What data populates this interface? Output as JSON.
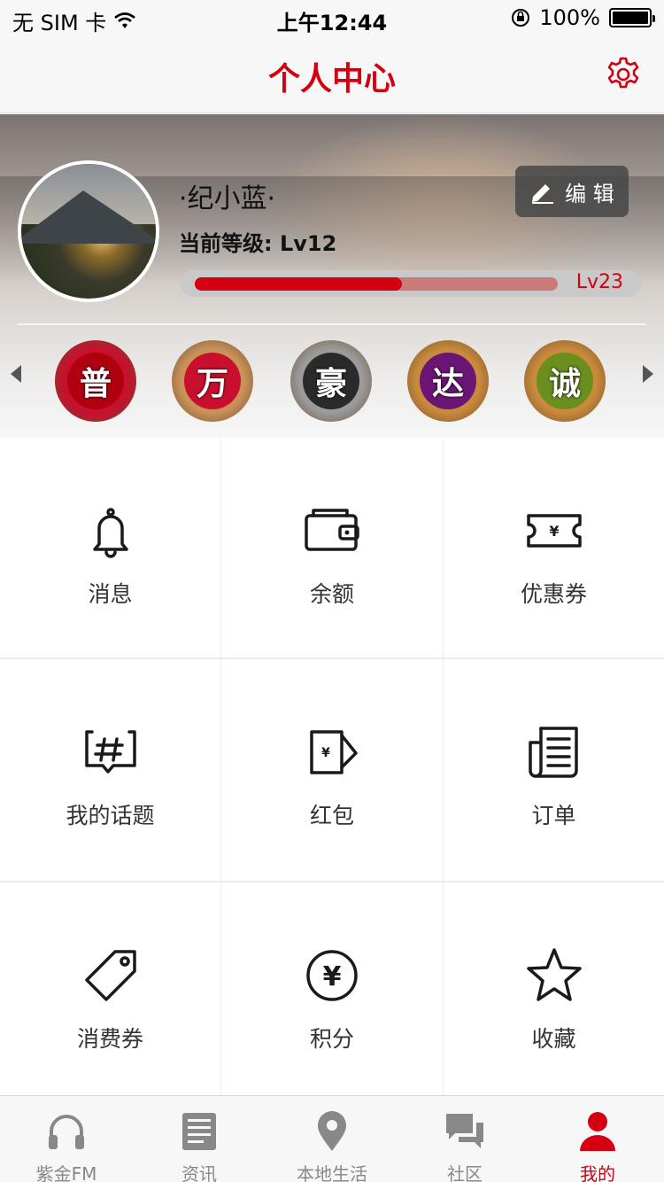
{
  "status_bar": {
    "carrier": "无 SIM 卡",
    "time": "上午12:44",
    "battery": "100%"
  },
  "nav": {
    "title": "个人中心",
    "settings_icon": "gear-icon"
  },
  "profile": {
    "username": "·纪小蓝·",
    "level_label": "当前等级: ",
    "level_value": "Lv12",
    "edit_label": "编 辑",
    "progress_fraction": 0.57,
    "next_level": "Lv23"
  },
  "badges": [
    {
      "char": "普",
      "ring": "#c8102e",
      "inner": "#b0000f"
    },
    {
      "char": "万",
      "ring": "#c9925a",
      "inner": "#c8102e"
    },
    {
      "char": "豪",
      "ring": "#9b9b9b",
      "inner": "#2a2a2a"
    },
    {
      "char": "达",
      "ring": "#c98a3c",
      "inner": "#6b1675"
    },
    {
      "char": "诚",
      "ring": "#c98a3c",
      "inner": "#6a8f1f"
    }
  ],
  "grid": [
    {
      "label": "消息",
      "icon": "bell-icon"
    },
    {
      "label": "余额",
      "icon": "wallet-icon"
    },
    {
      "label": "优惠券",
      "icon": "coupon-icon"
    },
    {
      "label": "我的话题",
      "icon": "topic-icon"
    },
    {
      "label": "红包",
      "icon": "red-envelope-icon"
    },
    {
      "label": "订单",
      "icon": "order-icon"
    },
    {
      "label": "消费券",
      "icon": "tag-icon"
    },
    {
      "label": "积分",
      "icon": "points-icon"
    },
    {
      "label": "收藏",
      "icon": "star-icon"
    }
  ],
  "tabs": [
    {
      "label": "紫金FM",
      "icon": "headphones-icon",
      "active": false
    },
    {
      "label": "资讯",
      "icon": "news-icon",
      "active": false
    },
    {
      "label": "本地生活",
      "icon": "location-icon",
      "active": false
    },
    {
      "label": "社区",
      "icon": "chat-icon",
      "active": false
    },
    {
      "label": "我的",
      "icon": "user-icon",
      "active": true
    }
  ],
  "colors": {
    "brand": "#d40012",
    "tab_inactive": "#888888"
  }
}
